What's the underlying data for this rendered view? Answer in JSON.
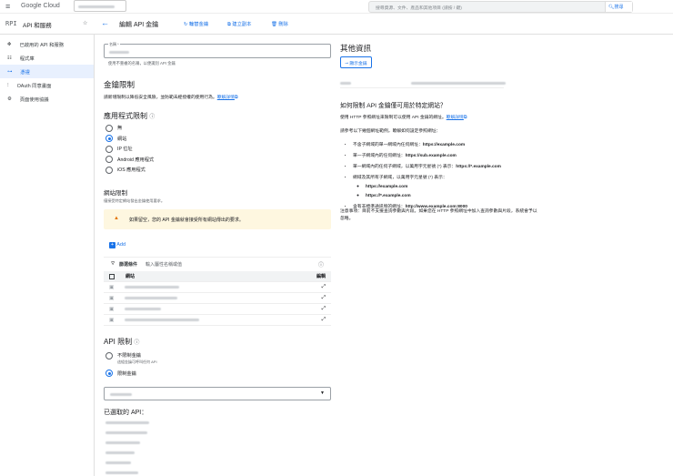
{
  "topbar": {
    "brand": "Google Cloud",
    "search_placeholder": "搜尋資源、文件、產品和其他項目 (請按 / 鍵)",
    "search_button": "搜尋"
  },
  "header": {
    "product": "API 和服務",
    "title": "編輯 API 金鑰",
    "actions": {
      "rotate": "輪替金鑰",
      "copy": "建立副本",
      "delete": "刪除"
    }
  },
  "sidebar": {
    "items": [
      {
        "label": "已啟用的 API 和服務"
      },
      {
        "label": "程式庫"
      },
      {
        "label": "憑證"
      },
      {
        "label": "OAuth 同意畫面"
      },
      {
        "label": "頁面使用協議"
      }
    ]
  },
  "form": {
    "name_label": "名稱 *",
    "name_hint": "使用不重複的名稱，以便識別 API 金鑰",
    "key_restrictions": {
      "title": "金鑰限制",
      "desc": "請新增限制以降低安全風險，並防範未經授權的使用行為。",
      "link": "瞭解詳情"
    },
    "app_restrictions": {
      "title": "應用程式限制",
      "options": [
        "無",
        "網站",
        "IP 位址",
        "Android 應用程式",
        "iOS 應用程式"
      ],
      "selected": 1
    },
    "website": {
      "title": "網站限制",
      "desc": "僅接受特定網站發出金鑰使用要求。",
      "warning": "如果留空，您的 API 金鑰就會接受所有網站傳出的要求。",
      "add": "Add",
      "filter_label": "篩選條件",
      "filter_placeholder": "輸入屬性名稱或值",
      "col_site": "網站",
      "col_edit": "編輯"
    },
    "api_restrictions": {
      "title": "API 限制",
      "opt_none": "不限制金鑰",
      "opt_none_desc": "這組金鑰可呼叫任何 API",
      "opt_restrict": "限制金鑰",
      "selected_title": "已選取的 API："
    }
  },
  "right": {
    "title": "其他資訊",
    "show_key": "顯示金鑰",
    "howto_title": "如何限制 API 金鑰僅可用於特定網站？",
    "howto_desc": "使用 HTTP 參照網址來限制可以使用 API 金鑰的網址。",
    "howto_link": "瞭解詳情",
    "examples_intro": "請參考以下幾個網址範例，瞭解如何設定參照網址：",
    "examples": [
      {
        "text": "不含子網域的單一網域內任何網址：",
        "url": "https://example.com"
      },
      {
        "text": "單一子網域內的任何網址：",
        "url": "https://sub.example.com"
      },
      {
        "text": "單一網域內的任何子網域，以萬用字元星號 (*) 表示：",
        "url": "https://*.example.com"
      },
      {
        "text": "網域及其所有子網域，以萬用字元星號 (*) 表示：",
        "url": ""
      }
    ],
    "sub_examples": [
      "https://example.com",
      "https://*.example.com"
    ],
    "last_example": {
      "text": "含有非標準通訊埠的網址：",
      "url": "http://www.example.com:8000"
    },
    "note": "注意事項：目前不支援查詢參數與片段。如果您在 HTTP 參照網址中加入查詢參數與片段，系統會予以忽略。"
  }
}
